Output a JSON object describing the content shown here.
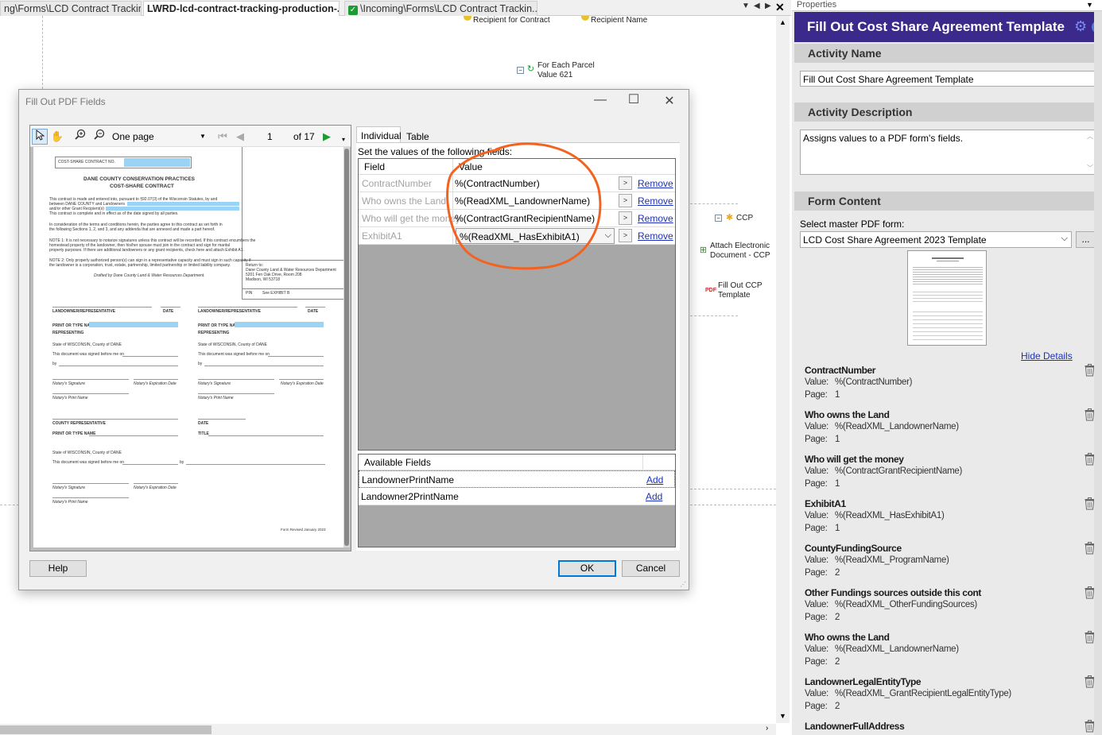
{
  "doc_tabs": [
    {
      "label": "ng\\Forms\\LCD Contract Trackin..."
    },
    {
      "label": "LWRD-lcd-contract-tracking-production-..."
    },
    {
      "label": "\\Incoming\\Forms\\LCD Contract Trackin..."
    }
  ],
  "workflow": {
    "recipient_for_contract": "Recipient for Contract",
    "recipient_name": "Recipient Name",
    "for_each_line1": "For Each Parcel",
    "for_each_line2": "Value 621",
    "ccp": "CCP",
    "attach_line1": "Attach Electronic",
    "attach_line2": "Document - CCP",
    "fill_ccp_line1": "Fill Out CCP",
    "fill_ccp_line2": "Template"
  },
  "dialog": {
    "title": "Fill Out PDF Fields",
    "toolbar": {
      "view_mode": "One page",
      "page_number": "1",
      "page_of": "of 17"
    },
    "tabs": {
      "individual": "Individual",
      "table": "Table"
    },
    "instruction": "Set the values of the following fields:",
    "grid": {
      "col_field": "Field",
      "col_value": "Value",
      "rows": [
        {
          "field": "ContractNumber",
          "value": "%(ContractNumber)",
          "action": "Remove"
        },
        {
          "field": "Who owns the Land",
          "value": "%(ReadXML_LandownerName)",
          "action": "Remove"
        },
        {
          "field": "Who will get the money",
          "value": "%(ContractGrantRecipientName)",
          "action": "Remove"
        },
        {
          "field": "ExhibitA1",
          "value": "%(ReadXML_HasExhibitA1)",
          "action": "Remove"
        }
      ]
    },
    "available": {
      "header": "Available Fields",
      "rows": [
        {
          "name": "LandownerPrintName",
          "action": "Add"
        },
        {
          "name": "Landowner2PrintName",
          "action": "Add"
        }
      ]
    },
    "buttons": {
      "help": "Help",
      "ok": "OK",
      "cancel": "Cancel"
    },
    "pdf": {
      "contract_no": "COST-SHARE CONTRACT NO.",
      "title1": "DANE COUNTY CONSERVATION PRACTICES",
      "title2": "COST-SHARE CONTRACT",
      "para1": "This contract is made and entered into, pursuant to §92.07(3) of the Wisconsin Statutes, by and",
      "para1b": "between DANE COUNTY and Landowners",
      "para1c": "and/or other Grant Recipient(s)",
      "para1d": "This contract is complete and in effect as of the date signed by all parties.",
      "para2": "In consideration of the terms and conditions herein, the parties agree to this contract as set forth in",
      "para2b": "the following Sections 1, 2, and 3, and any addenda that are annexed and made a part hereof.",
      "note1": "NOTE 1: It is not necessary to notarize signatures unless this contract will be recorded. If this contract encumbers the",
      "note1b": "homestead property of the landowner, then his/her spouse must join in the contract and sign for marital",
      "note1c": "property purposes.  If there are additional landowners or any grant recipients, check here    and attach Exhibit A1.",
      "note2": "NOTE 2: Only properly authorized person(s) can sign in a representative capacity and must sign in such capacity if",
      "note2b": "the landowner is a corporation, trust, estate, partnership, limited partnership or limited liability company.",
      "drafted": "Drafted by Dane County Land & Water Resources Department.",
      "return_to": "Return to:",
      "return_1": "Dane County Land & Water Resources Department",
      "return_2": "5201 Fen Oak Drive, Room 208",
      "return_3": "Madison, WI 53718",
      "pin": "PIN",
      "see_exhibit": "See EXHIBIT B",
      "landowner_rep": "LANDOWNER/REPRESENTATIVE",
      "date": "DATE",
      "print_name": "PRINT OR TYPE NAME",
      "representing": "REPRESENTING",
      "state_of": "State of WISCONSIN, County of DANE",
      "signed_before": "This document was signed before me on",
      "by": "by",
      "notary_sig": "Notary's Signature",
      "notary_exp": "Notary's Expiration Date",
      "notary_print": "Notary's Print Name",
      "county_rep": "COUNTY REPRESENTATIVE",
      "title_lbl": "TITLE",
      "form_revised": "Form Revised January 2023"
    }
  },
  "properties": {
    "panel_label": "Properties",
    "header": "Fill Out Cost Share Agreement Template",
    "activity_name_label": "Activity Name",
    "activity_name_value": "Fill Out Cost Share Agreement Template",
    "activity_desc_label": "Activity Description",
    "activity_desc_value": "Assigns values to a PDF form's fields.",
    "form_content_label": "Form Content",
    "select_master_label": "Select master PDF form:",
    "select_master_value": "LCD Cost Share Agreement 2023 Template",
    "browse_button": "...",
    "hide_details": "Hide Details",
    "value_label": "Value:",
    "page_label": "Page:",
    "fields": [
      {
        "name": "ContractNumber",
        "value": "%(ContractNumber)",
        "page": "1"
      },
      {
        "name": "Who owns the Land",
        "value": "%(ReadXML_LandownerName)",
        "page": "1"
      },
      {
        "name": "Who will get the money",
        "value": "%(ContractGrantRecipientName)",
        "page": "1"
      },
      {
        "name": "ExhibitA1",
        "value": "%(ReadXML_HasExhibitA1)",
        "page": "1"
      },
      {
        "name": "CountyFundingSource",
        "value": "%(ReadXML_ProgramName)",
        "page": "2"
      },
      {
        "name": "Other Fundings sources outside this cont",
        "value": "%(ReadXML_OtherFundingSources)",
        "page": "2"
      },
      {
        "name": "Who owns the Land",
        "value": "%(ReadXML_LandownerName)",
        "page": "2"
      },
      {
        "name": "LandownerLegalEntityType",
        "value": "%(ReadXML_GrantRecipientLegalEntityType)",
        "page": "2"
      },
      {
        "name": "LandownerFullAddress",
        "value": "",
        "page": ""
      }
    ]
  },
  "colors": {
    "accent_purple": "#3b2a8c",
    "annotation": "#f26322",
    "link": "#1c31b8"
  },
  "icons": [
    "close-icon",
    "chevron-down-icon",
    "gear-icon",
    "help-icon",
    "trash-icon",
    "pointer-icon",
    "hand-icon",
    "zoom-in-icon",
    "zoom-out-icon",
    "first-page-icon",
    "prev-page-icon",
    "next-page-icon",
    "loop-icon",
    "pdf-icon",
    "attach-icon",
    "checkbox-icon"
  ]
}
